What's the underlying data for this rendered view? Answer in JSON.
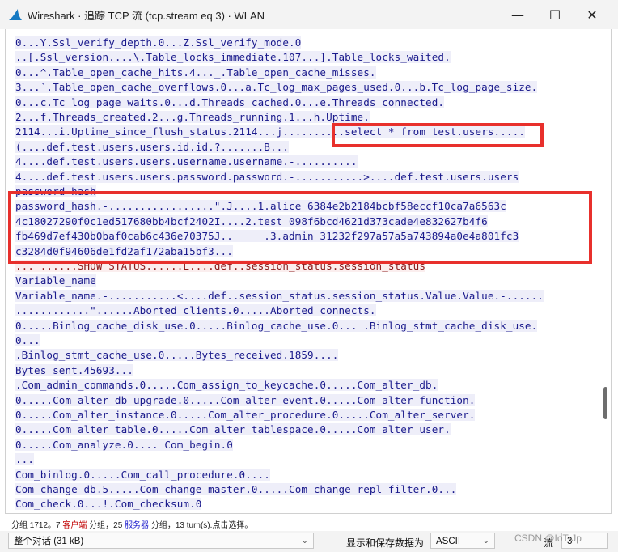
{
  "window": {
    "title": "Wireshark · 追踪 TCP 流 (tcp.stream eq 3) · WLAN",
    "minimize": "—",
    "maximize": "☐",
    "close": "✕"
  },
  "stream_lines": [
    {
      "text": "0...Y.Ssl_verify_depth.0...Z.Ssl_verify_mode.0",
      "side": "client"
    },
    {
      "text": "..[.Ssl_version....\\.Table_locks_immediate.107...].Table_locks_waited.",
      "side": "client"
    },
    {
      "text": "0...^.Table_open_cache_hits.4..._.Table_open_cache_misses.",
      "side": "client"
    },
    {
      "text": "3...`.Table_open_cache_overflows.0...a.Tc_log_max_pages_used.0...b.Tc_log_page_size.",
      "side": "client"
    },
    {
      "text": "0...c.Tc_log_page_waits.0...d.Threads_cached.0...e.Threads_connected.",
      "side": "client"
    },
    {
      "text": "2...f.Threads_created.2...g.Threads_running.1...h.Uptime.",
      "side": "client"
    },
    {
      "text": "2114...i.Uptime_since_flush_status.2114...j..........select * from test.users.....",
      "side": "client"
    },
    {
      "text": "(....def.test.users.users.id.id.?.......B...",
      "side": "client"
    },
    {
      "text": "4....def.test.users.users.username.username.-..........",
      "side": "client"
    },
    {
      "text": "4....def.test.users.users.password.password.-...........>....def.test.users.users",
      "side": "client"
    },
    {
      "text": "password_hash",
      "side": "client"
    },
    {
      "text": "password_hash.-.................\".J....1.alice 6384e2b2184bcbf58eccf10ca7a6563c",
      "side": "client"
    },
    {
      "text": "4c18027290f0c1ed517680bb4bcf2402I....2.test 098f6bcd4621d373cade4e832627b4f6",
      "side": "client"
    },
    {
      "text": "fb469d7ef430b0baf0cab6c436e70375J..     .3.admin 31232f297a57a5a743894a0e4a801fc3",
      "side": "client"
    },
    {
      "text": "c3284d0f94606de1fd2af172aba15bf3...",
      "side": "client"
    },
    {
      "text": "... ......SHOW STATUS......L....def..session_status.session_status",
      "side": "server"
    },
    {
      "text": "Variable_name",
      "side": "client"
    },
    {
      "text": "Variable_name.-...........<....def..session_status.session_status.Value.Value.-......",
      "side": "client"
    },
    {
      "text": "............\"......Aborted_clients.0.....Aborted_connects.",
      "side": "client"
    },
    {
      "text": "0.....Binlog_cache_disk_use.0.....Binlog_cache_use.0... .Binlog_stmt_cache_disk_use.",
      "side": "client"
    },
    {
      "text": "0...",
      "side": "client"
    },
    {
      "text": ".Binlog_stmt_cache_use.0.....Bytes_received.1859....",
      "side": "client"
    },
    {
      "text": "Bytes_sent.45693...",
      "side": "client"
    },
    {
      "text": ".Com_admin_commands.0.....Com_assign_to_keycache.0.....Com_alter_db.",
      "side": "client"
    },
    {
      "text": "0.....Com_alter_db_upgrade.0.....Com_alter_event.0.....Com_alter_function.",
      "side": "client"
    },
    {
      "text": "0.....Com_alter_instance.0.....Com_alter_procedure.0.....Com_alter_server.",
      "side": "client"
    },
    {
      "text": "0.....Com_alter_table.0.....Com_alter_tablespace.0.....Com_alter_user.",
      "side": "client"
    },
    {
      "text": "0.....Com_analyze.0.... Com_begin.0",
      "side": "client"
    },
    {
      "text": "...",
      "side": "client"
    },
    {
      "text": "Com_binlog.0.....Com_call_procedure.0....",
      "side": "client"
    },
    {
      "text": "Com_change_db.5.....Com_change_master.0.....Com_change_repl_filter.0...",
      "side": "client"
    },
    {
      "text": "Com_check.0...!.Com_checksum.0",
      "side": "client"
    }
  ],
  "status_bar": {
    "prefix": "分组 1712。7 ",
    "client_label": "客户端",
    "middle": " 分组，25 ",
    "server_label": "服务器",
    "suffix": " 分组，13 turn(s).点击选择。"
  },
  "bottom_bar": {
    "conversation_select": "整个对话 (31 kB)",
    "format_label": "显示和保存数据为",
    "format_select": "ASCII",
    "stream_label": "流",
    "stream_value": "3"
  },
  "watermark": "CSDN @IoT-Jp",
  "colors": {
    "client_text": "#1a1a8c",
    "client_bg": "#eeeef9",
    "server_text": "#8a1a1a",
    "server_bg": "#fbeeee",
    "annotation_red": "#e8302c"
  },
  "icons": {
    "app": "wireshark-fin-icon",
    "chevron": "chevron-down-icon"
  }
}
